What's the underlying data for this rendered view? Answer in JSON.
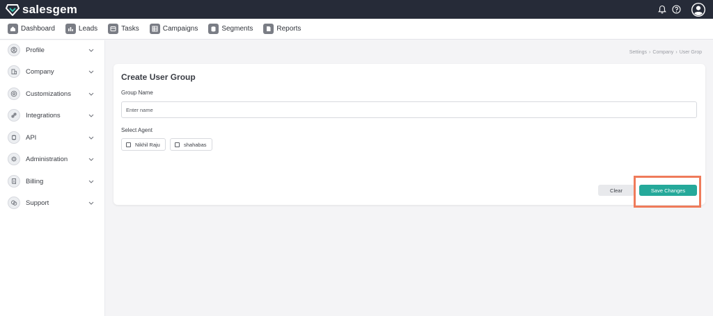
{
  "app": {
    "brand": "salesgem"
  },
  "header": {
    "icons": [
      "bell-icon",
      "help-icon",
      "user-avatar-icon"
    ]
  },
  "nav": {
    "items": [
      {
        "label": "Dashboard",
        "icon": "home-icon"
      },
      {
        "label": "Leads",
        "icon": "leads-icon"
      },
      {
        "label": "Tasks",
        "icon": "tasks-icon"
      },
      {
        "label": "Campaigns",
        "icon": "campaigns-icon"
      },
      {
        "label": "Segments",
        "icon": "segments-icon"
      },
      {
        "label": "Reports",
        "icon": "reports-icon"
      }
    ]
  },
  "sidebar": {
    "items": [
      {
        "label": "Profile",
        "icon": "profile-icon"
      },
      {
        "label": "Company",
        "icon": "company-icon"
      },
      {
        "label": "Customizations",
        "icon": "customizations-icon"
      },
      {
        "label": "Integrations",
        "icon": "integrations-icon"
      },
      {
        "label": "API",
        "icon": "api-icon"
      },
      {
        "label": "Administration",
        "icon": "administration-icon"
      },
      {
        "label": "Billing",
        "icon": "billing-icon"
      },
      {
        "label": "Support",
        "icon": "support-icon"
      }
    ]
  },
  "breadcrumb": [
    "Settings",
    "Company",
    "User Grop"
  ],
  "form": {
    "title": "Create User Group",
    "group_name_label": "Group Name",
    "group_name_placeholder": "Enter name",
    "group_name_value": "",
    "select_agent_label": "Select Agent",
    "agents": [
      {
        "label": "Nikhil Raju",
        "checked": false
      },
      {
        "label": "shahabas",
        "checked": false
      }
    ],
    "clear_label": "Clear",
    "save_label": "Save Changes"
  },
  "colors": {
    "topbar": "#262b38",
    "accent": "#25a99a",
    "highlight": "#ef7b5a"
  }
}
